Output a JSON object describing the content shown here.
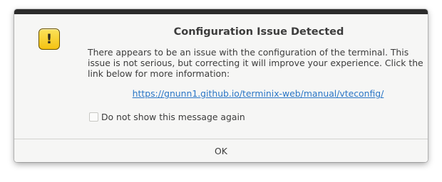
{
  "dialog": {
    "title": "Configuration Issue Detected",
    "message": "There appears to be an issue with the configuration of the terminal. This issue is not serious, but correcting it will improve your experience. Click the link below for more information:",
    "link_text": "https://gnunn1.github.io/terminix-web/manual/vteconfig/",
    "checkbox": {
      "label": "Do not show this message again",
      "checked": false
    },
    "ok_label": "OK",
    "icon": {
      "name": "warning-icon",
      "glyph": "!",
      "color": "#f5c211"
    }
  },
  "colors": {
    "link": "#2a76c6",
    "titlebar": "#2b2b2b",
    "background": "#f6f6f5"
  }
}
